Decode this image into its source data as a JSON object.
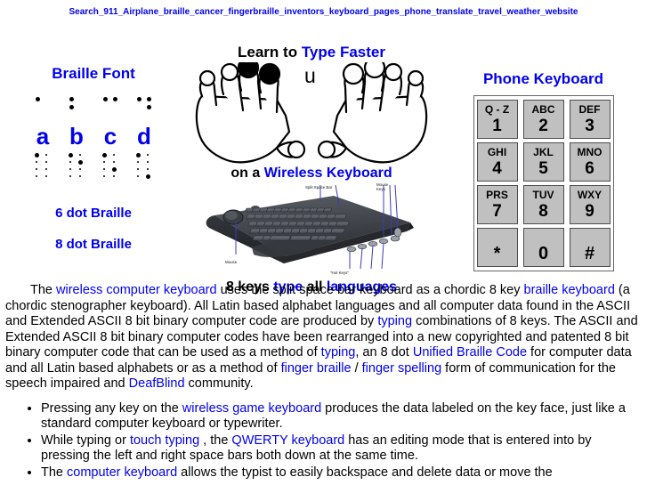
{
  "topbar": {
    "keywords": "Search_911_Airplane_braille_cancer_fingerbraille_inventors_keyboard_pages_phone_translate_travel_weather_website"
  },
  "braille_panel": {
    "title": "Braille Font",
    "letters": [
      "a",
      "b",
      "c",
      "d"
    ],
    "six_dot_patterns": [
      [
        1
      ],
      [
        1,
        2
      ],
      [
        1,
        4
      ],
      [
        1,
        4,
        5
      ]
    ],
    "eight_dot_patterns": [
      [
        1
      ],
      [
        2
      ],
      [
        4
      ],
      [
        8
      ]
    ],
    "label_six": "6 dot Braille",
    "label_eight": "8 dot Braille"
  },
  "center_panel": {
    "headline_plain": "Learn to ",
    "headline_blue": "Type Faster",
    "u_glyph": "u",
    "subline_plain": "on a ",
    "subline_blue": "Wireless Keyboard",
    "keyboard_labels": {
      "split_space_bar": "Split Space Bar",
      "mouse_keys": "Mouse Keys",
      "mouse": "Mouse",
      "hot_keys": "\"Hot Keys\""
    },
    "caption_1": "8 keys ",
    "caption_blue_1": "type",
    "caption_2": " all ",
    "caption_blue_2": "languages"
  },
  "phone_panel": {
    "title": "Phone Keyboard",
    "keys": [
      [
        {
          "letters": "Q - Z",
          "digit": "1"
        },
        {
          "letters": "ABC",
          "digit": "2"
        },
        {
          "letters": "DEF",
          "digit": "3"
        }
      ],
      [
        {
          "letters": "GHI",
          "digit": "4"
        },
        {
          "letters": "JKL",
          "digit": "5"
        },
        {
          "letters": "MNO",
          "digit": "6"
        }
      ],
      [
        {
          "letters": "PRS",
          "digit": "7"
        },
        {
          "letters": "TUV",
          "digit": "8"
        },
        {
          "letters": "WXY",
          "digit": "9"
        }
      ],
      [
        {
          "letters": "",
          "digit": "*"
        },
        {
          "letters": "",
          "digit": "0"
        },
        {
          "letters": "",
          "digit": "#"
        }
      ]
    ]
  },
  "body": {
    "paragraph": [
      {
        "t": "The ",
        "link": false
      },
      {
        "t": "wireless computer keyboard",
        "link": true
      },
      {
        "t": " uses the split space bar keyboard as a chordic 8 key ",
        "link": false
      },
      {
        "t": "braille keyboard",
        "link": true
      },
      {
        "t": " (a chordic stenographer keyboard). All Latin based alphabet languages and all computer data found in the ASCII and Extended ASCII 8 bit binary computer code are produced by ",
        "link": false
      },
      {
        "t": "typing",
        "link": true
      },
      {
        "t": " combinations of 8 keys. The ASCII and Extended ASCII 8 bit binary computer codes have been rearranged into a new copyrighted and patented 8 bit binary computer code that can be used as a method of ",
        "link": false
      },
      {
        "t": "typing",
        "link": true
      },
      {
        "t": ", an 8 dot ",
        "link": false
      },
      {
        "t": "Unified Braille Code",
        "link": true
      },
      {
        "t": " for computer data and all Latin based alphabets or as a method of ",
        "link": false
      },
      {
        "t": "finger braille",
        "link": true
      },
      {
        "t": " / ",
        "link": false
      },
      {
        "t": "finger spelling",
        "link": true
      },
      {
        "t": " form of communication for the speech impaired and ",
        "link": false
      },
      {
        "t": "DeafBlind",
        "link": true
      },
      {
        "t": " community.",
        "link": false
      }
    ],
    "bullets": [
      [
        {
          "t": "Pressing any key on the ",
          "link": false
        },
        {
          "t": "wireless game keyboard",
          "link": true
        },
        {
          "t": " produces the data labeled on the key face, just like a standard computer keyboard or typewriter.",
          "link": false
        }
      ],
      [
        {
          "t": "While typing or ",
          "link": false
        },
        {
          "t": "touch typing",
          "link": true
        },
        {
          "t": " , the ",
          "link": false
        },
        {
          "t": "QWERTY keyboard",
          "link": true
        },
        {
          "t": " has an editing mode that is entered into by pressing the left and right space bars both down at the same time.",
          "link": false
        }
      ],
      [
        {
          "t": "The ",
          "link": false
        },
        {
          "t": "computer keyboard",
          "link": true
        },
        {
          "t": " allows the typist to easily backspace and delete data or move the",
          "link": false
        }
      ]
    ]
  },
  "colors": {
    "link_blue": "#0000ee",
    "text_black": "#000000",
    "key_gray": "#c0c0c0",
    "keyboard_body": "#3c3f44"
  }
}
